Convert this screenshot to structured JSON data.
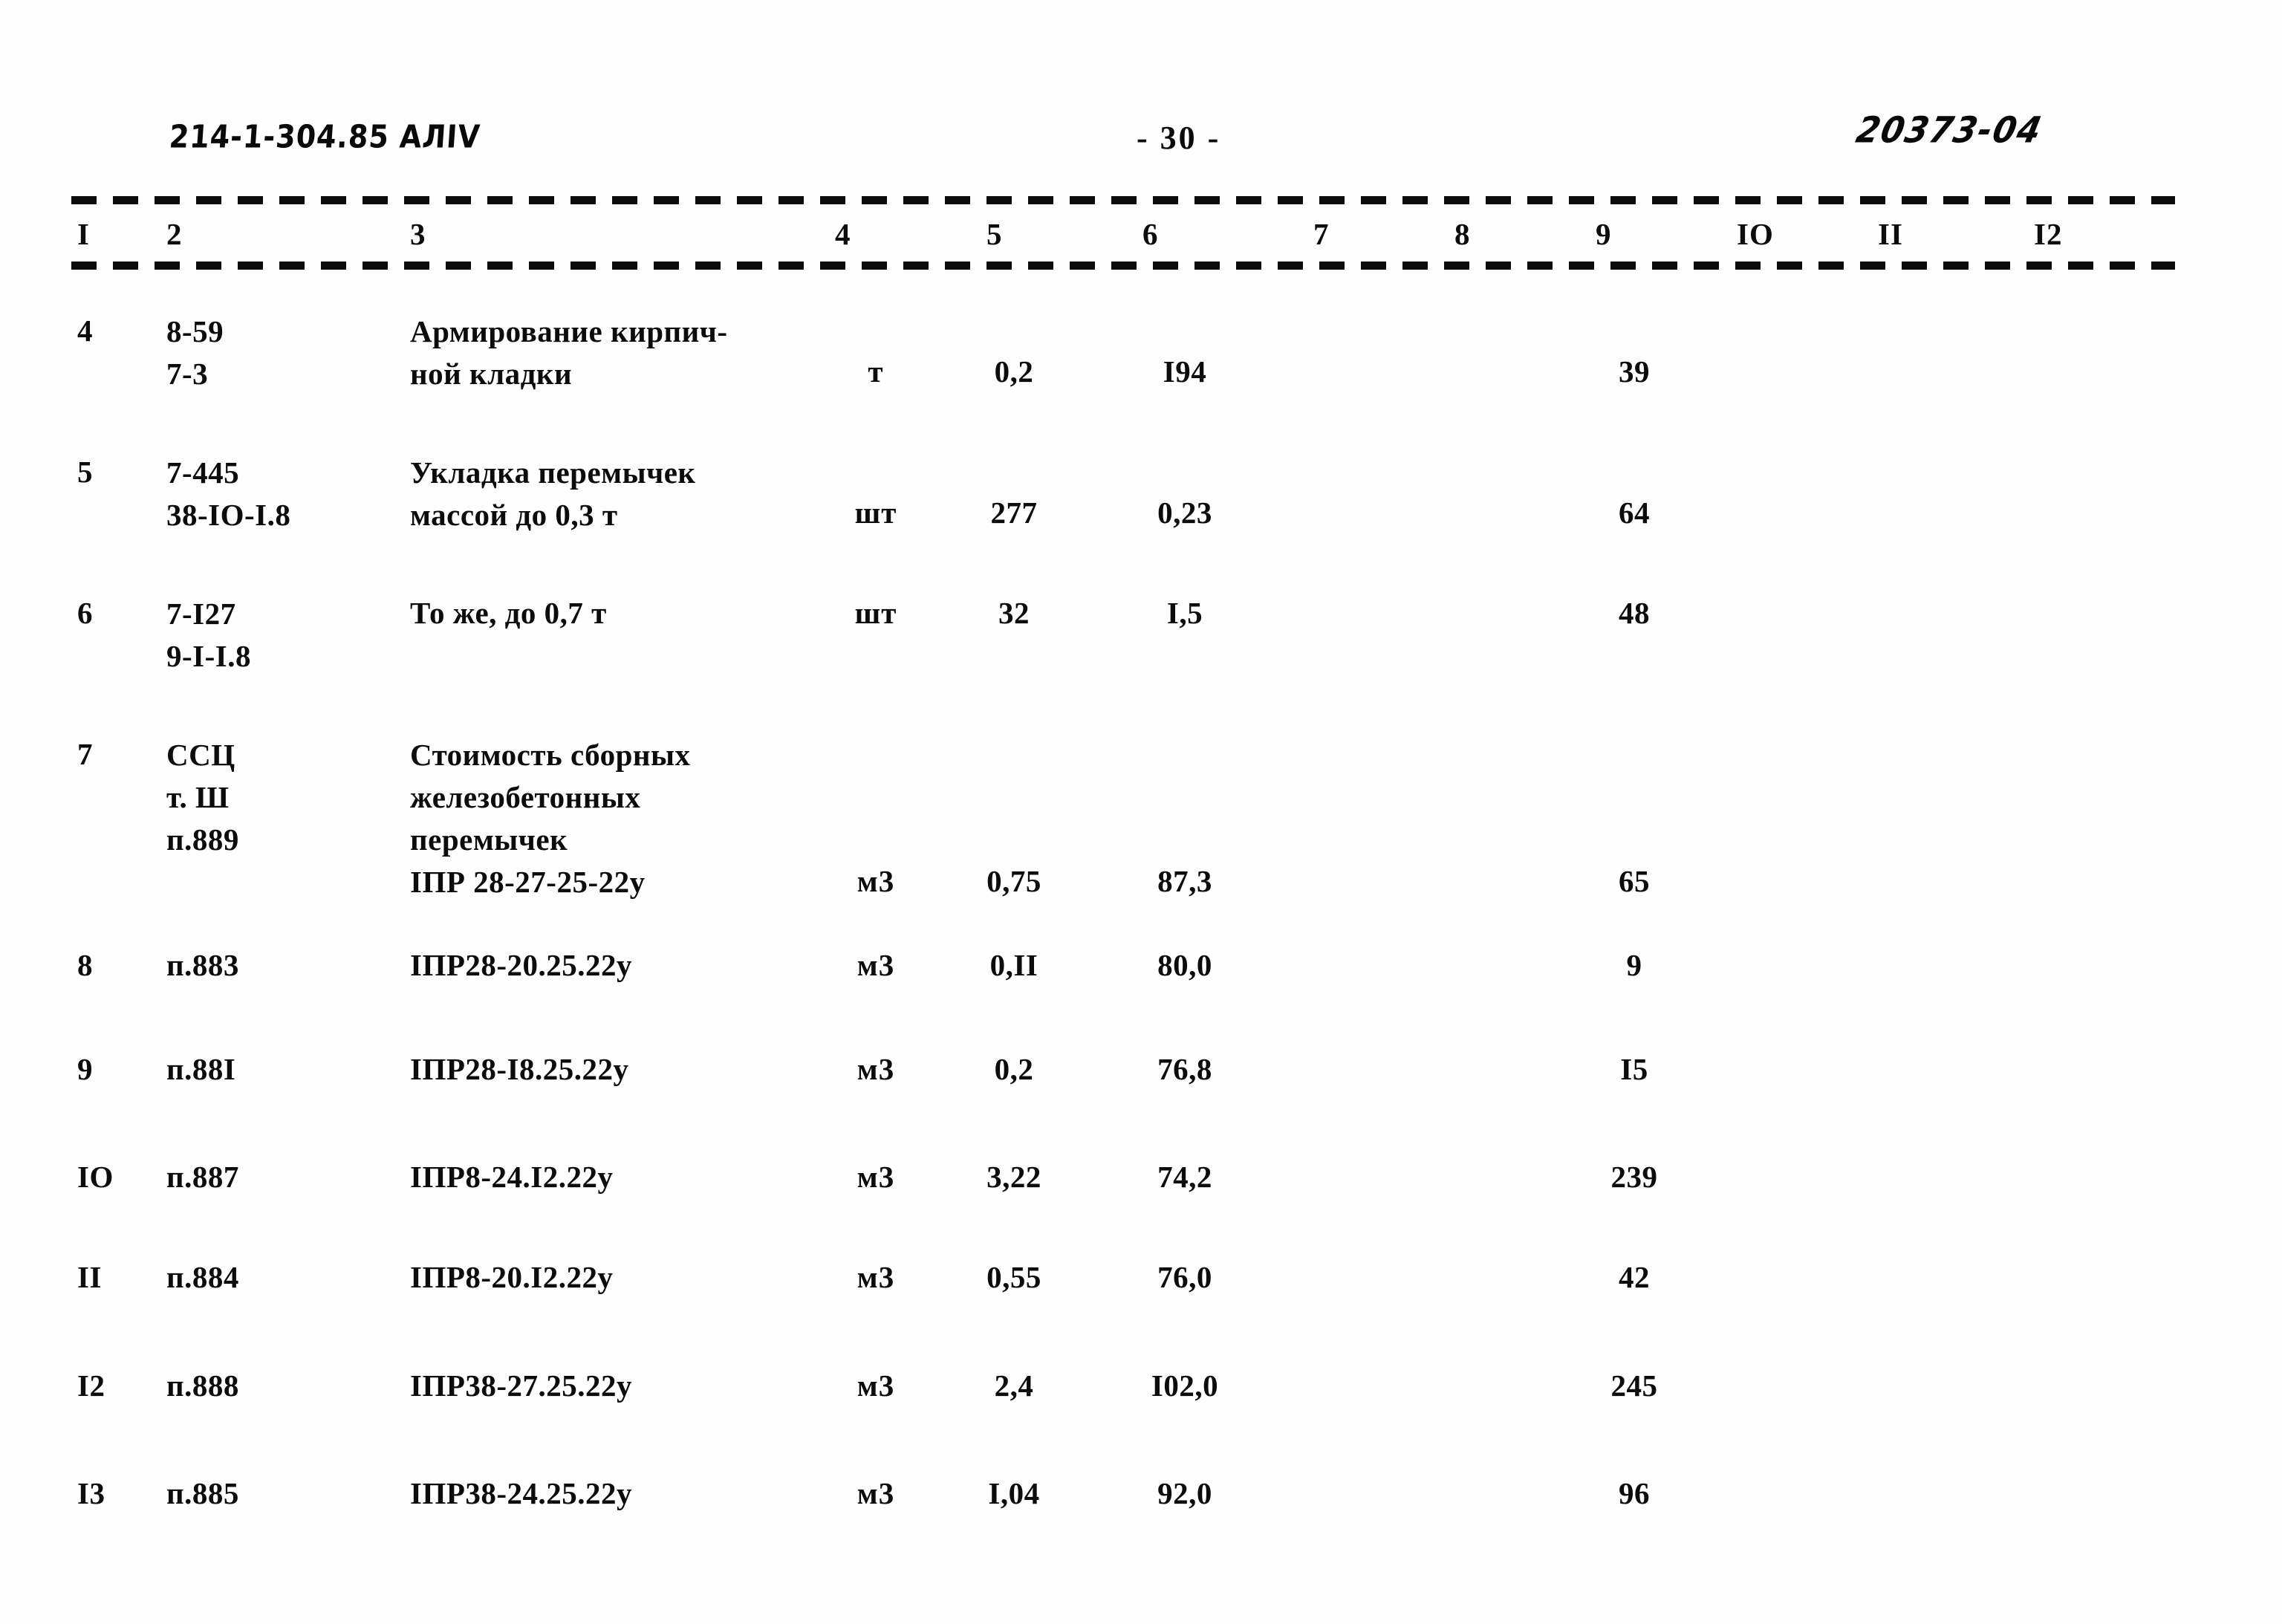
{
  "header": {
    "doc_code": "214-1-304.85  АЛIV",
    "page_number": "- 30 -",
    "stamp_number": "20373-04"
  },
  "table": {
    "column_headers": [
      "I",
      "2",
      "3",
      "4",
      "5",
      "6",
      "7",
      "8",
      "9",
      "IO",
      "II",
      "I2"
    ],
    "rows": [
      {
        "num": "4",
        "code": "8-59\n7-3",
        "name": "Армирование кирпич-\nной кладки",
        "unit": "т",
        "qty": "0,2",
        "price": "I94",
        "c7": "",
        "c8": "",
        "total": "39",
        "c10": "",
        "c11": "",
        "c12": ""
      },
      {
        "num": "5",
        "code": "7-445\n38-IO-I.8",
        "name": "Укладка перемычек\nмассой до 0,3 т",
        "unit": "шт",
        "qty": "277",
        "price": "0,23",
        "c7": "",
        "c8": "",
        "total": "64",
        "c10": "",
        "c11": "",
        "c12": ""
      },
      {
        "num": "6",
        "code": "7-I27\n9-I-I.8",
        "name": "То же, до 0,7 т",
        "unit": "шт",
        "qty": "32",
        "price": "I,5",
        "c7": "",
        "c8": "",
        "total": "48",
        "c10": "",
        "c11": "",
        "c12": ""
      },
      {
        "num": "7",
        "code": "ССЦ\nт. Ш\nп.889",
        "name": "Стоимость сборных\nжелезобетонных\nперемычек\nIПР 28-27-25-22у",
        "unit": "м3",
        "qty": "0,75",
        "price": "87,3",
        "c7": "",
        "c8": "",
        "total": "65",
        "c10": "",
        "c11": "",
        "c12": ""
      },
      {
        "num": "8",
        "code": "п.883",
        "name": "IПР28-20.25.22у",
        "unit": "м3",
        "qty": "0,II",
        "price": "80,0",
        "c7": "",
        "c8": "",
        "total": "9",
        "c10": "",
        "c11": "",
        "c12": ""
      },
      {
        "num": "9",
        "code": "п.88I",
        "name": "IПР28-I8.25.22у",
        "unit": "м3",
        "qty": "0,2",
        "price": "76,8",
        "c7": "",
        "c8": "",
        "total": "I5",
        "c10": "",
        "c11": "",
        "c12": ""
      },
      {
        "num": "IO",
        "code": "п.887",
        "name": "IПР8-24.I2.22у",
        "unit": "м3",
        "qty": "3,22",
        "price": "74,2",
        "c7": "",
        "c8": "",
        "total": "239",
        "c10": "",
        "c11": "",
        "c12": ""
      },
      {
        "num": "II",
        "code": "п.884",
        "name": "IПР8-20.I2.22у",
        "unit": "м3",
        "qty": "0,55",
        "price": "76,0",
        "c7": "",
        "c8": "",
        "total": "42",
        "c10": "",
        "c11": "",
        "c12": ""
      },
      {
        "num": "I2",
        "code": "п.888",
        "name": "IПР38-27.25.22у",
        "unit": "м3",
        "qty": "2,4",
        "price": "I02,0",
        "c7": "",
        "c8": "",
        "total": "245",
        "c10": "",
        "c11": "",
        "c12": ""
      },
      {
        "num": "I3",
        "code": "п.885",
        "name": "IПР38-24.25.22у",
        "unit": "м3",
        "qty": "I,04",
        "price": "92,0",
        "c7": "",
        "c8": "",
        "total": "96",
        "c10": "",
        "c11": "",
        "c12": ""
      }
    ]
  }
}
